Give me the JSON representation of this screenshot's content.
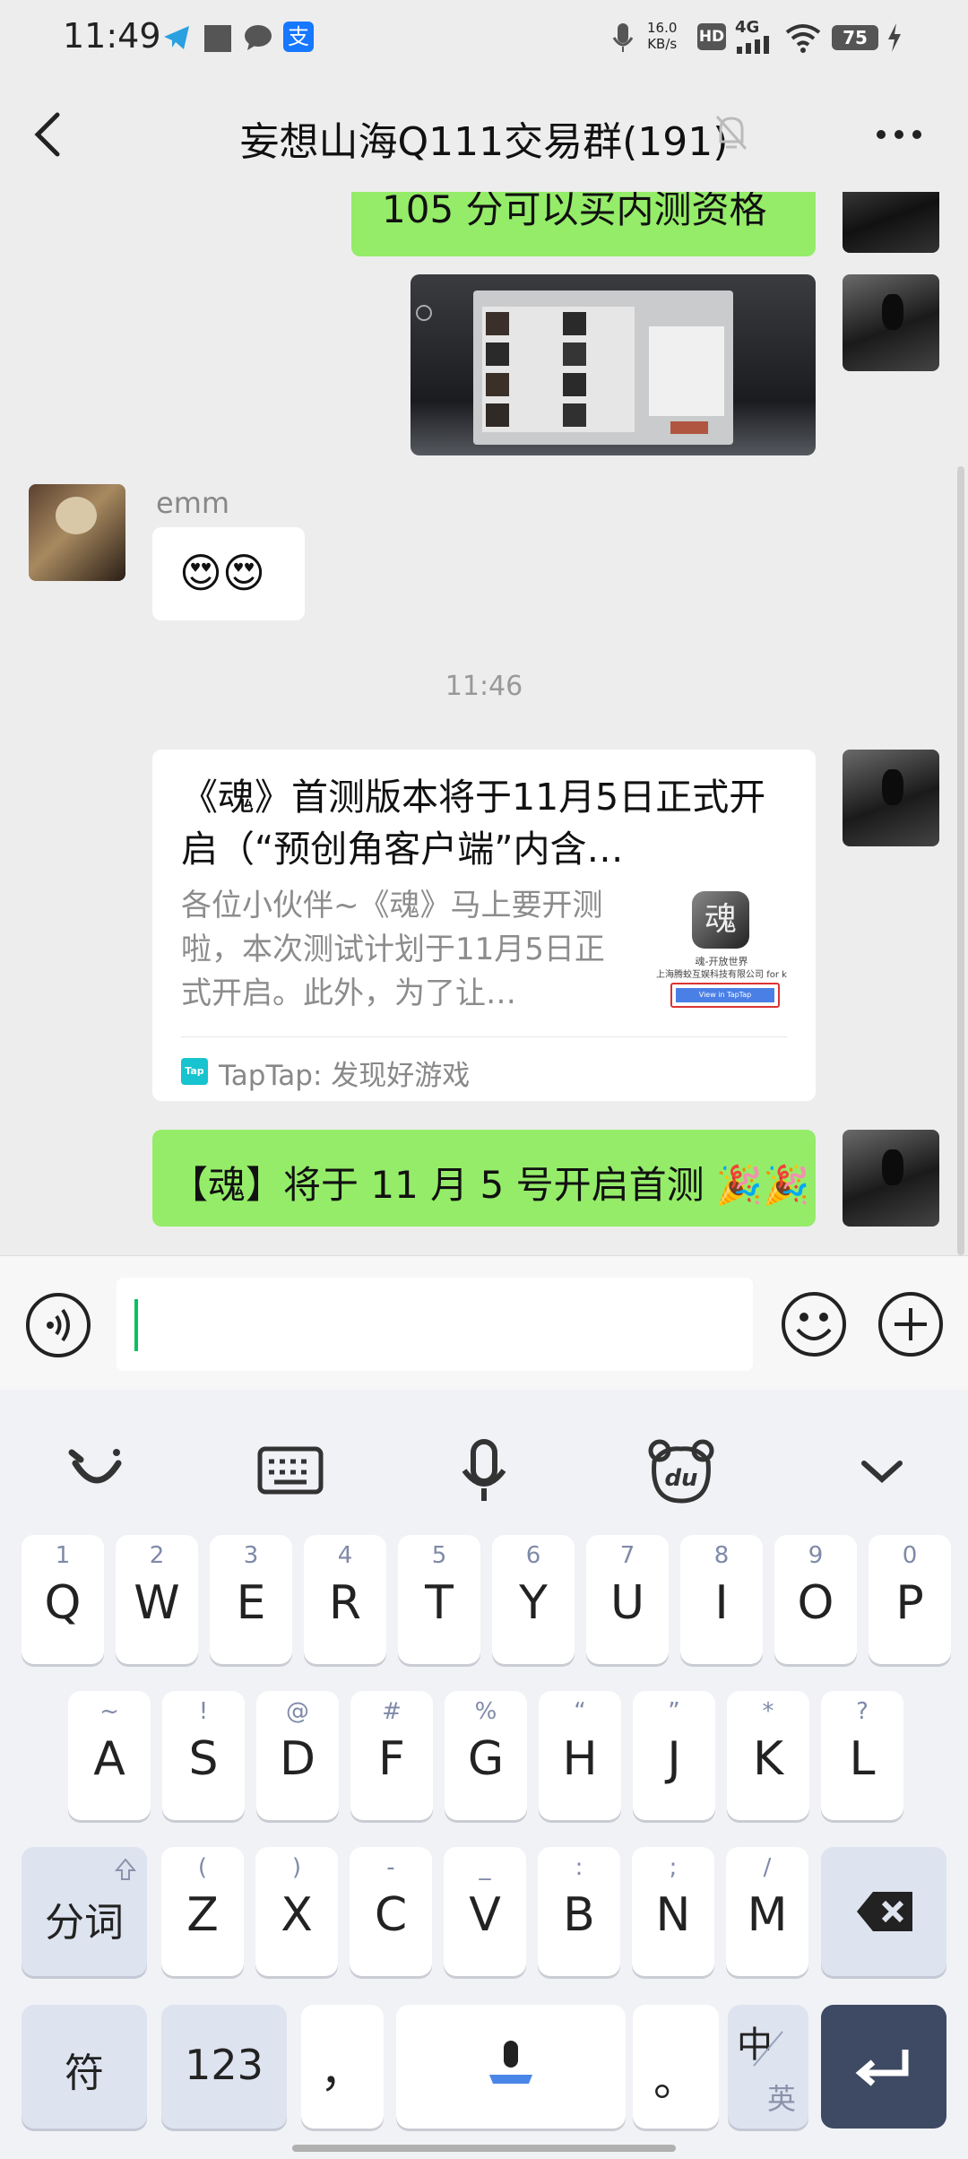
{
  "status_bar": {
    "time": "11:49",
    "net_speed_value": "16.0",
    "net_speed_unit": "KB/s",
    "hd_label": "HD",
    "network_label": "4G",
    "battery": "75"
  },
  "header": {
    "title": "妄想山海Q111交易群(191)"
  },
  "chat": {
    "partial_message": "105 分可以买内测资格",
    "emm_sender": "emm",
    "emm_message": "😍😍",
    "timestamp": "11:46",
    "link_card": {
      "title": "《魂》首测版本将于11月5日正式开启（“预创角客户端”内含…",
      "description": "各位小伙伴~《魂》马上要开测啦，本次测试计划于11月5日正式开启。此外，为了让…",
      "source_label": "TapTap: 发现好游戏",
      "source_icon_text": "Tap",
      "thumb_caption_1": "魂-开放世界",
      "thumb_caption_2": "上海腾蛟互娱科技有限公司 for k",
      "thumb_button": "View in TapTap"
    },
    "last_message": "【魂】将于 11 月 5 号开启首测 🎉🎉"
  },
  "keyboard": {
    "row1": [
      {
        "hint": "1",
        "main": "Q"
      },
      {
        "hint": "2",
        "main": "W"
      },
      {
        "hint": "3",
        "main": "E"
      },
      {
        "hint": "4",
        "main": "R"
      },
      {
        "hint": "5",
        "main": "T"
      },
      {
        "hint": "6",
        "main": "Y"
      },
      {
        "hint": "7",
        "main": "U"
      },
      {
        "hint": "8",
        "main": "I"
      },
      {
        "hint": "9",
        "main": "O"
      },
      {
        "hint": "0",
        "main": "P"
      }
    ],
    "row2": [
      {
        "hint": "~",
        "main": "A"
      },
      {
        "hint": "!",
        "main": "S"
      },
      {
        "hint": "@",
        "main": "D"
      },
      {
        "hint": "#",
        "main": "F"
      },
      {
        "hint": "%",
        "main": "G"
      },
      {
        "hint": "“",
        "main": "H"
      },
      {
        "hint": "”",
        "main": "J"
      },
      {
        "hint": "*",
        "main": "K"
      },
      {
        "hint": "?",
        "main": "L"
      }
    ],
    "row3": [
      {
        "hint": "(",
        "main": "Z"
      },
      {
        "hint": ")",
        "main": "X"
      },
      {
        "hint": "-",
        "main": "C"
      },
      {
        "hint": "_",
        "main": "V"
      },
      {
        "hint": ":",
        "main": "B"
      },
      {
        "hint": ";",
        "main": "N"
      },
      {
        "hint": "/",
        "main": "M"
      }
    ],
    "fenci": "分词",
    "fu": "符",
    "num": "123",
    "comma": "，",
    "period": "。",
    "lang_main": "中",
    "lang_alt": "英"
  }
}
